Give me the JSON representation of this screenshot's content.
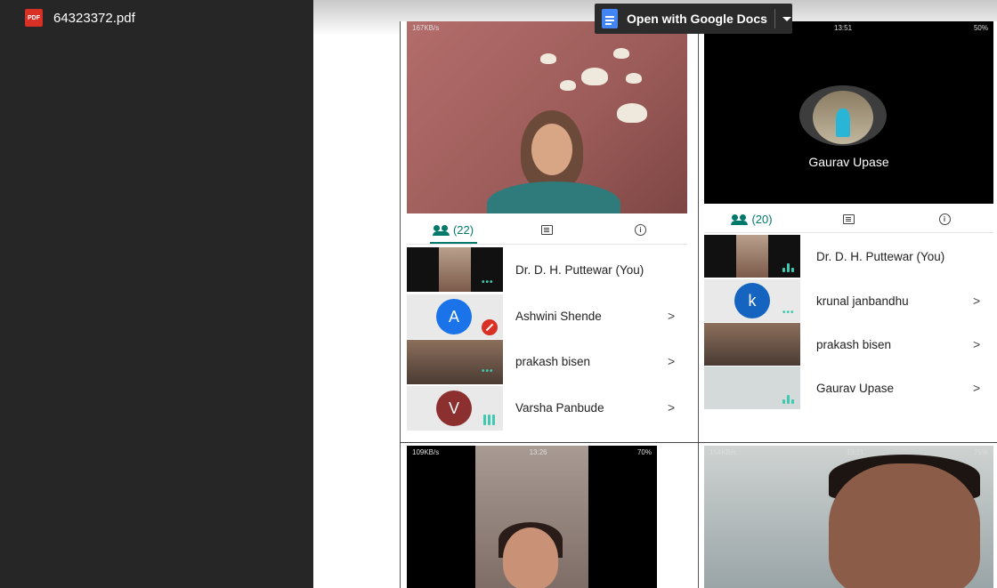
{
  "file": {
    "icon_label": "PDF",
    "name": "64323372.pdf"
  },
  "open_with": {
    "label": "Open with Google Docs"
  },
  "panel1": {
    "status": "167KB/s",
    "tabs": {
      "participants": "(22)"
    },
    "rows": [
      {
        "name": "Dr. D. H. Puttewar (You)",
        "chevron": ""
      },
      {
        "name": "Ashwini Shende",
        "avatar_letter": "A",
        "avatar_color": "#1a73e8",
        "chevron": ">"
      },
      {
        "name": "prakash bisen",
        "chevron": ">"
      },
      {
        "name": "Varsha Panbude",
        "avatar_letter": "V",
        "avatar_color": "#8c2f2f",
        "chevron": ">"
      }
    ]
  },
  "panel2": {
    "status_time": "13:51",
    "status_right": "50%",
    "video_name": "Gaurav Upase",
    "tabs": {
      "participants": "(20)"
    },
    "rows": [
      {
        "name": "Dr. D. H. Puttewar (You)",
        "chevron": ""
      },
      {
        "name": "krunal janbandhu",
        "avatar_letter": "k",
        "avatar_color": "#1565c0",
        "chevron": ">"
      },
      {
        "name": "prakash bisen",
        "chevron": ">"
      },
      {
        "name": "Gaurav Upase",
        "chevron": ">"
      }
    ]
  },
  "panel3": {
    "status_left": "109KB/s",
    "status_time": "13:26",
    "status_right": "70%"
  },
  "panel4": {
    "status_left": "154KB/s",
    "status_time": "13:21",
    "status_right": "75%"
  },
  "colors": {
    "accent": "#00796b",
    "sidebar": "#262626",
    "docs_blue": "#4285f4"
  }
}
